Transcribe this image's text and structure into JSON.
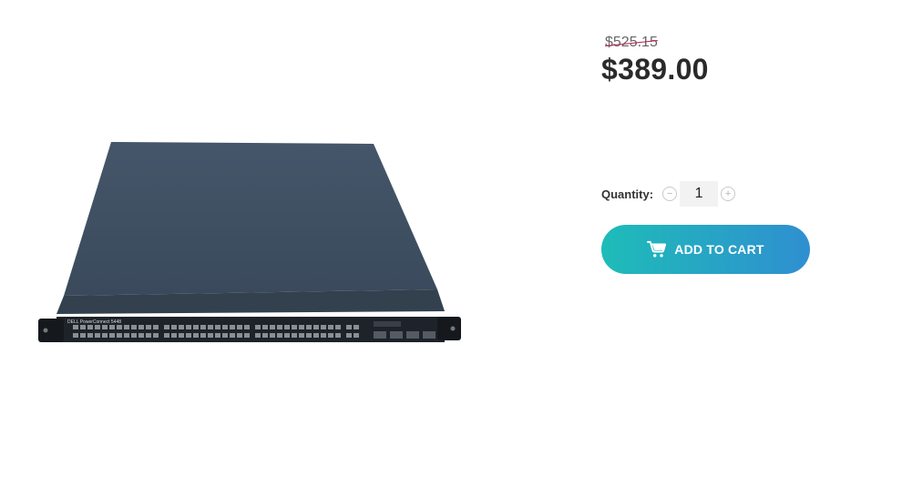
{
  "product": {
    "old_price": "$525.15",
    "price": "$389.00",
    "image_caption": "DELL PowerConnect 5448"
  },
  "quantity": {
    "label": "Quantity:",
    "value": "1",
    "decrement_symbol": "−",
    "increment_symbol": "+"
  },
  "cart": {
    "button_label": "ADD TO CART",
    "icon": "shopping-cart-icon"
  },
  "colors": {
    "button_gradient_start": "#1ebcb8",
    "button_gradient_end": "#2f8fd0",
    "strike_color": "#c2185b"
  }
}
